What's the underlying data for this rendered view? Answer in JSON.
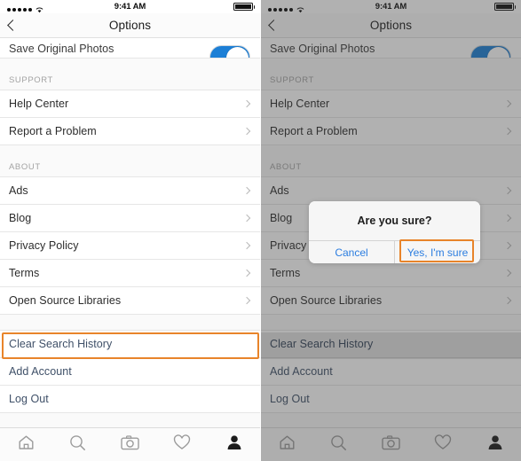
{
  "statusbar": {
    "time": "9:41 AM",
    "signal_dots": 5,
    "wifi_icon": "wifi-icon",
    "battery_icon": "battery-full-icon"
  },
  "navbar": {
    "title": "Options",
    "back_icon": "chevron-left-icon"
  },
  "toggle_row": {
    "label": "Save Original Photos",
    "state": "on"
  },
  "sections": [
    {
      "header": "SUPPORT",
      "items": [
        {
          "label": "Help Center",
          "accessory": "chevron-right-icon"
        },
        {
          "label": "Report a Problem",
          "accessory": "chevron-right-icon"
        }
      ]
    },
    {
      "header": "ABOUT",
      "items": [
        {
          "label": "Ads",
          "accessory": "chevron-right-icon"
        },
        {
          "label": "Blog",
          "accessory": "chevron-right-icon"
        },
        {
          "label": "Privacy Policy",
          "accessory": "chevron-right-icon"
        },
        {
          "label": "Terms",
          "accessory": "chevron-right-icon"
        },
        {
          "label": "Open Source Libraries",
          "accessory": "chevron-right-icon"
        }
      ]
    }
  ],
  "account_actions": [
    {
      "label": "Clear Search History"
    },
    {
      "label": "Add Account"
    },
    {
      "label": "Log Out"
    }
  ],
  "tabbar": {
    "tabs": [
      {
        "icon": "home-icon",
        "active": false
      },
      {
        "icon": "search-icon",
        "active": false
      },
      {
        "icon": "camera-icon",
        "active": false
      },
      {
        "icon": "heart-icon",
        "active": false
      },
      {
        "icon": "profile-icon",
        "active": true
      }
    ]
  },
  "dialog": {
    "title": "Are you sure?",
    "cancel_label": "Cancel",
    "confirm_label": "Yes, I'm sure"
  },
  "colors": {
    "highlight": "#e8842a",
    "link_blue": "#2b7de0",
    "toggle_on": "#1c7fd6",
    "action_text": "#3f5068"
  }
}
